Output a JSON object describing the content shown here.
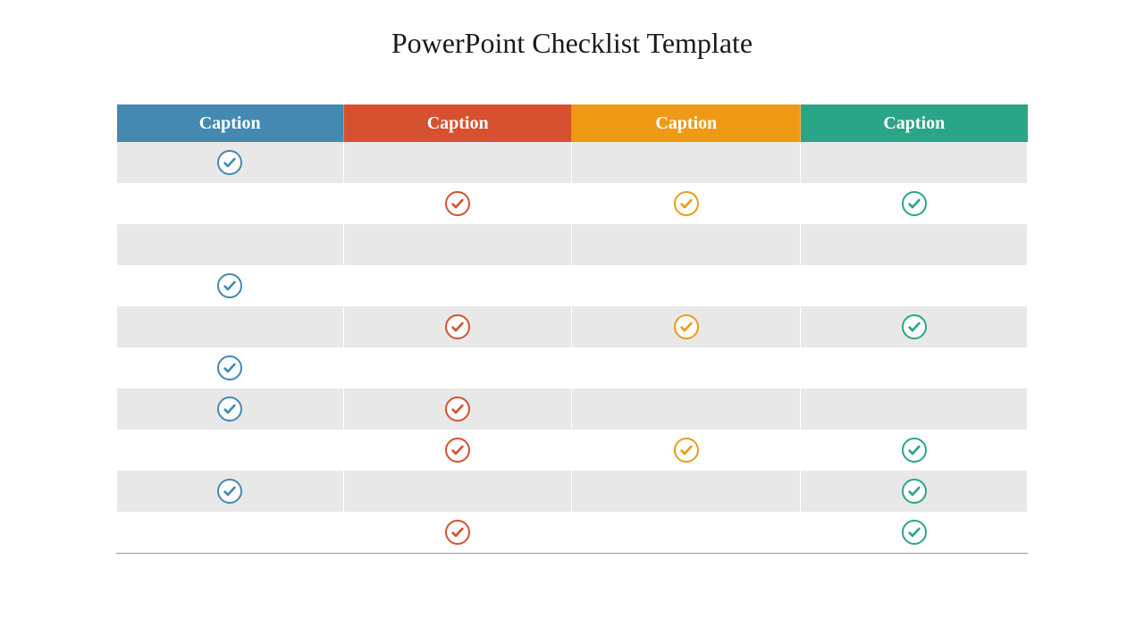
{
  "title": "PowerPoint Checklist Template",
  "columns": [
    {
      "label": "Caption",
      "color": "#4489b1"
    },
    {
      "label": "Caption",
      "color": "#d6512f"
    },
    {
      "label": "Caption",
      "color": "#ee9a15"
    },
    {
      "label": "Caption",
      "color": "#2ba587"
    }
  ],
  "rows": [
    [
      true,
      false,
      false,
      false
    ],
    [
      false,
      true,
      true,
      true
    ],
    [
      false,
      false,
      false,
      false
    ],
    [
      true,
      false,
      false,
      false
    ],
    [
      false,
      true,
      true,
      true
    ],
    [
      true,
      false,
      false,
      false
    ],
    [
      true,
      true,
      false,
      false
    ],
    [
      false,
      true,
      true,
      true
    ],
    [
      true,
      false,
      false,
      true
    ],
    [
      false,
      true,
      false,
      true
    ]
  ]
}
